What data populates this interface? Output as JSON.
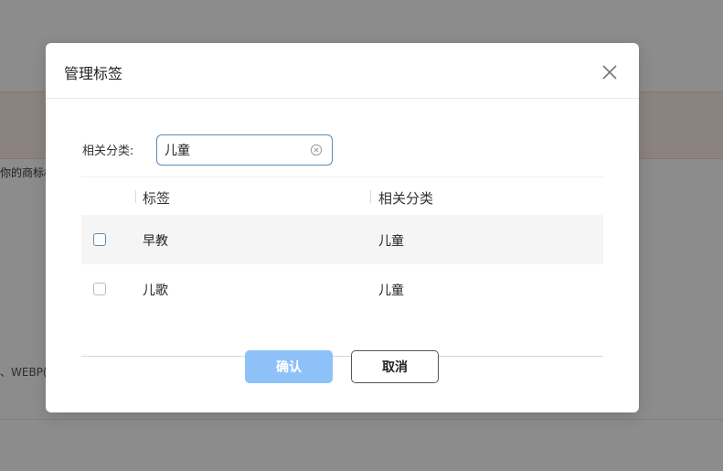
{
  "background": {
    "text_fragment_1": "你的商标权",
    "text_fragment_2": "、WEBP("
  },
  "modal": {
    "title": "管理标签",
    "filter": {
      "label": "相关分类:",
      "value": "儿童"
    },
    "table": {
      "columns": [
        "标签",
        "相关分类"
      ],
      "rows": [
        {
          "tag": "早教",
          "category": "儿童",
          "checked": false
        },
        {
          "tag": "儿歌",
          "category": "儿童",
          "checked": false
        }
      ]
    },
    "buttons": {
      "confirm": "确认",
      "cancel": "取消"
    }
  },
  "colors": {
    "primary_disabled": "#8ec1f7",
    "input_border": "#5b8bb5",
    "alert_bg": "#fdeee6"
  }
}
